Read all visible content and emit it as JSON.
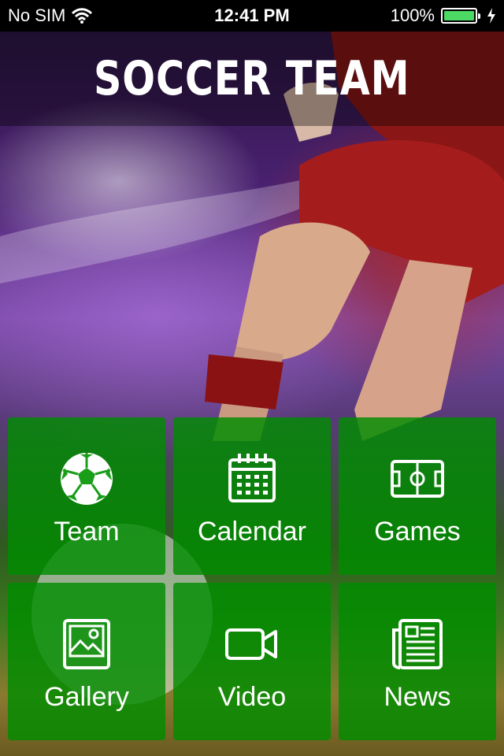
{
  "status_bar": {
    "carrier": "No SIM",
    "time": "12:41 PM",
    "battery": "100%",
    "battery_level": 1.0
  },
  "header": {
    "title": "SOCCER TEAM"
  },
  "menu": [
    {
      "label": "Team",
      "icon": "soccer-ball-icon"
    },
    {
      "label": "Calendar",
      "icon": "calendar-icon"
    },
    {
      "label": "Games",
      "icon": "soccer-field-icon"
    },
    {
      "label": "Gallery",
      "icon": "image-icon"
    },
    {
      "label": "Video",
      "icon": "video-camera-icon"
    },
    {
      "label": "News",
      "icon": "newspaper-icon"
    }
  ],
  "colors": {
    "tile": "#008c00",
    "battery": "#4cd964"
  }
}
